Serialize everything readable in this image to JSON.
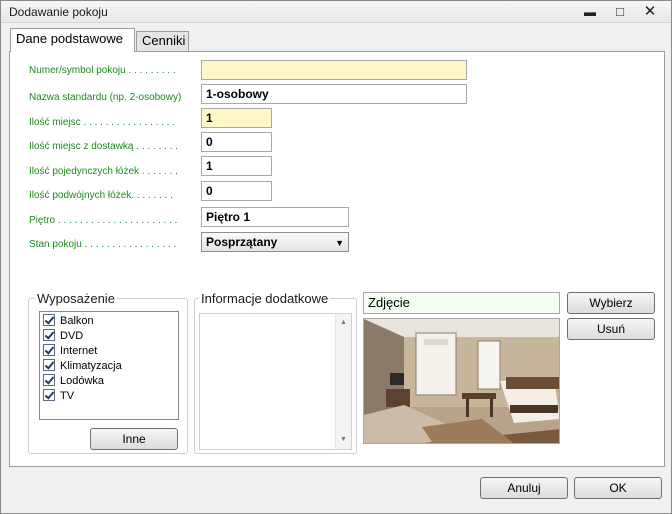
{
  "window": {
    "title": "Dodawanie pokoju",
    "minimize_glyph": "▬",
    "maximize_glyph": "□",
    "close_glyph": "✕"
  },
  "tabs": [
    {
      "label": "Dane podstawowe",
      "active": true
    },
    {
      "label": "Cenniki",
      "active": false
    }
  ],
  "form": {
    "numer": {
      "label": "Numer/symbol pokoju . . . . . . . . .",
      "value": ""
    },
    "standard": {
      "label": "Nazwa standardu (np. 2-osobowy)",
      "value": "1-osobowy"
    },
    "miejsc": {
      "label": "Ilość miejsc . . . . . . . . . . . . . . . . .",
      "value": "1"
    },
    "dostawka": {
      "label": "Ilość miejsc z dostawką . . . . . . . .",
      "value": "0"
    },
    "pojedyncze": {
      "label": "Ilość pojedynczych łóżek . . . . . . .",
      "value": "1"
    },
    "podwojne": {
      "label": "Ilość podwójnych łóżek. . . . . . . .",
      "value": "0"
    },
    "pietro": {
      "label": "Piętro . . . . . . . . . . . . . . . . . . . . . .",
      "value": "Piętro 1"
    },
    "stan": {
      "label": "Stan pokoju . . . . . . . . . . . . . . . . .",
      "value": "Posprzątany",
      "arrow": "▼"
    }
  },
  "equipment": {
    "title": "Wyposażenie",
    "items": [
      "Balkon",
      "DVD",
      "Internet",
      "Klimatyzacja",
      "Lodówka",
      "TV"
    ],
    "button": "Inne"
  },
  "info": {
    "title": "Informacje dodatkowe",
    "scroll_up": "▲",
    "scroll_down": "▼"
  },
  "photo": {
    "label": "Zdjęcie",
    "choose_button": "Wybierz",
    "remove_button": "Usuń"
  },
  "footer": {
    "cancel": "Anuluj",
    "ok": "OK"
  },
  "colors": {
    "label_green": "#1e8a1e",
    "required_yellow": "#fff7c7"
  }
}
